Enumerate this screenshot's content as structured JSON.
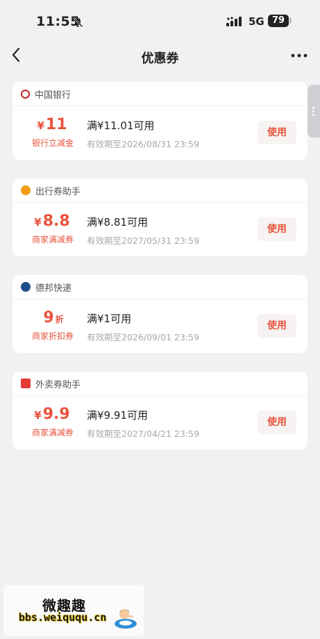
{
  "status_bar": {
    "time": "11:55",
    "network": "5G",
    "battery": "79"
  },
  "nav": {
    "title": "优惠券"
  },
  "coupons": [
    {
      "merchant": "中国银行",
      "logo_color": "#c62828",
      "currency": "¥",
      "value": "11",
      "unit": "",
      "type": "银行立减金",
      "condition": "满¥11.01可用",
      "expiry": "有效期至2026/08/31 23:59",
      "button": "使用"
    },
    {
      "merchant": "出行券助手",
      "logo_color": "#f39c12",
      "currency": "¥",
      "value": "8.8",
      "unit": "",
      "type": "商家满减券",
      "condition": "满¥8.81可用",
      "expiry": "有效期至2027/05/31 23:59",
      "button": "使用"
    },
    {
      "merchant": "德邦快递",
      "logo_color": "#1f4e8c",
      "currency": "",
      "value": "9",
      "unit": "折",
      "type": "商家折扣券",
      "condition": "满¥1可用",
      "expiry": "有效期至2026/09/01 23:59",
      "button": "使用"
    },
    {
      "merchant": "外卖券助手",
      "logo_color": "#e53935",
      "currency": "¥",
      "value": "9.9",
      "unit": "",
      "type": "商家满减券",
      "condition": "满¥9.91可用",
      "expiry": "有效期至2027/04/21 23:59",
      "button": "使用"
    }
  ],
  "watermark": {
    "name": "微趣趣",
    "url": "bbs.weiququ.cn"
  },
  "colors": {
    "accent": "#e7533b",
    "background": "#f1f1f3"
  }
}
